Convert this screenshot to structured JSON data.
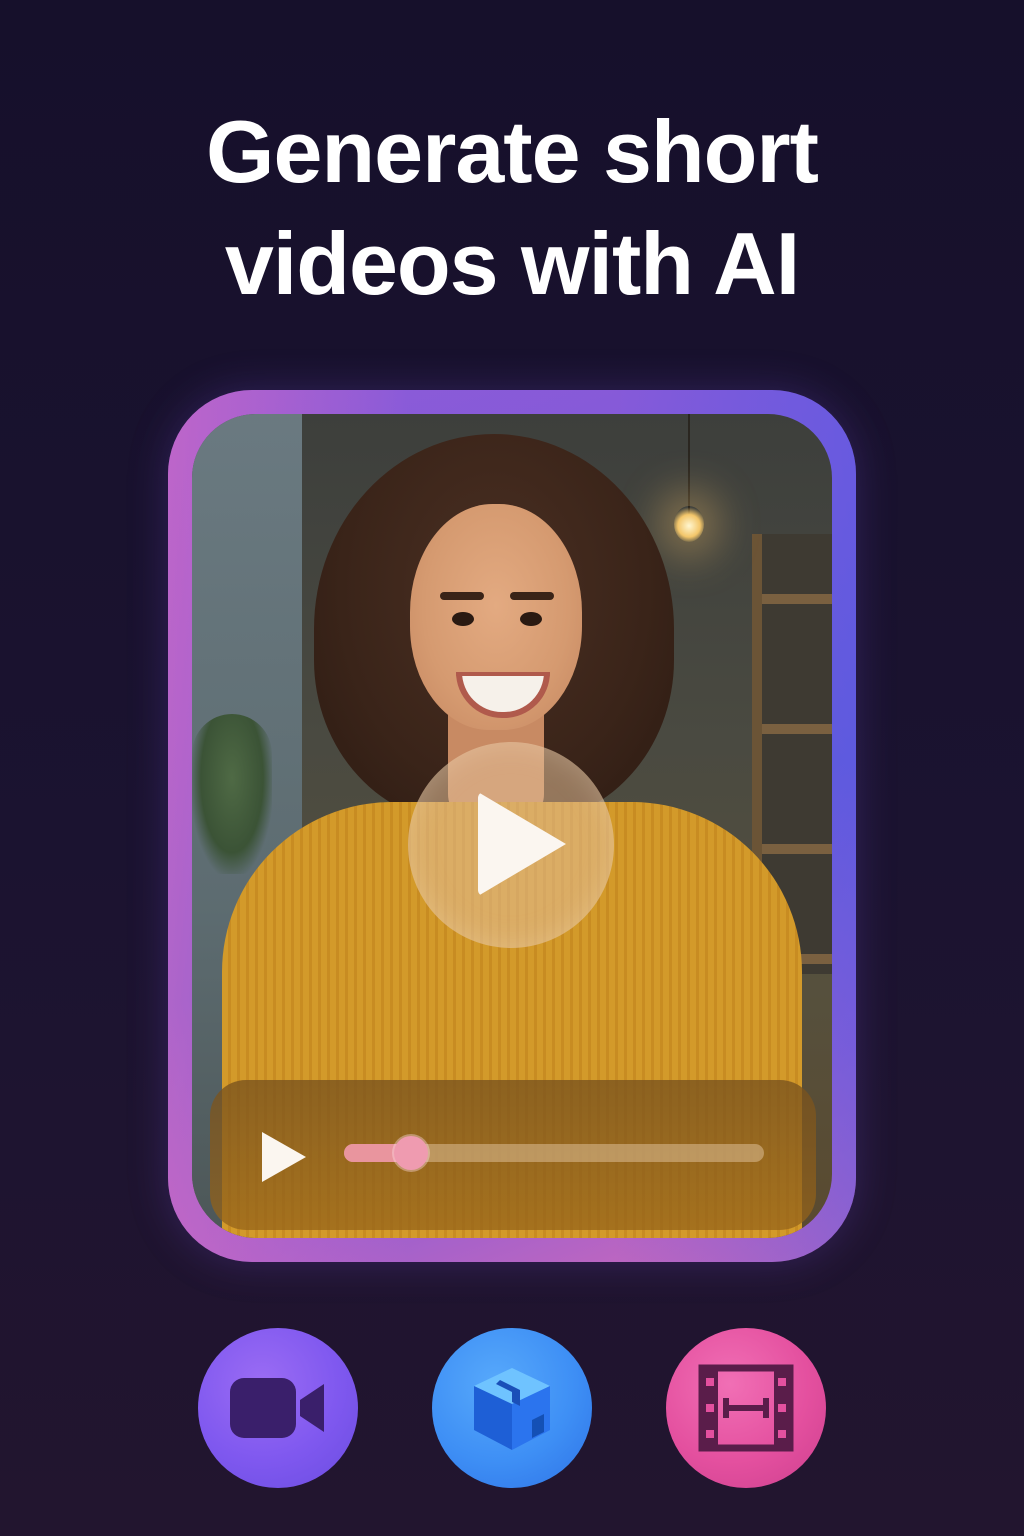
{
  "headline": {
    "line1": "Generate short",
    "line2": "videos with AI"
  },
  "player": {
    "state": "paused",
    "progress_fraction": 0.16
  },
  "tools": [
    {
      "icon": "video-camera-icon"
    },
    {
      "icon": "cube-icon"
    },
    {
      "icon": "film-strip-icon"
    }
  ],
  "colors": {
    "background": "#16102b",
    "frame_gradient_start": "#d06ab8",
    "frame_gradient_end": "#5a5ad8",
    "tool_video": "#7f58ef",
    "tool_cube": "#3e8ff5",
    "tool_film": "#e4509f",
    "progress_fill": "#e9959e"
  }
}
